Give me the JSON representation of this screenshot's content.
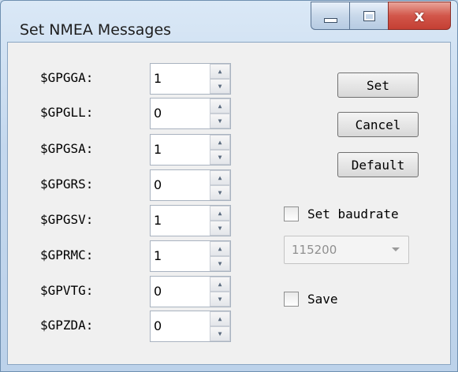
{
  "window": {
    "title": "Set NMEA Messages"
  },
  "messages": [
    {
      "label": "$GPGGA:",
      "value": "1"
    },
    {
      "label": "$GPGLL:",
      "value": "0"
    },
    {
      "label": "$GPGSA:",
      "value": "1"
    },
    {
      "label": "$GPGRS:",
      "value": "0"
    },
    {
      "label": "$GPGSV:",
      "value": "1"
    },
    {
      "label": "$GPRMC:",
      "value": "1"
    },
    {
      "label": "$GPVTG:",
      "value": "0"
    },
    {
      "label": "$GPZDA:",
      "value": "0"
    }
  ],
  "buttons": {
    "set": "Set",
    "cancel": "Cancel",
    "default": "Default"
  },
  "baudrate": {
    "checkbox_label": "Set baudrate",
    "checked": false,
    "selected": "115200",
    "enabled": false
  },
  "save": {
    "checkbox_label": "Save",
    "checked": false
  }
}
